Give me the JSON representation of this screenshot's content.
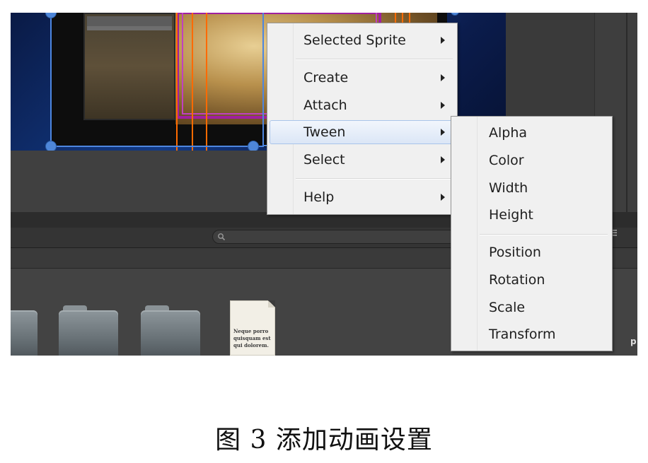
{
  "context_menu": {
    "items": [
      {
        "label": "Selected Sprite",
        "has_submenu": true
      },
      {
        "label": "Create",
        "has_submenu": true
      },
      {
        "label": "Attach",
        "has_submenu": true
      },
      {
        "label": "Tween",
        "has_submenu": true,
        "highlighted": true
      },
      {
        "label": "Select",
        "has_submenu": true
      },
      {
        "label": "Help",
        "has_submenu": true
      }
    ]
  },
  "tween_submenu": {
    "items": [
      {
        "label": "Alpha"
      },
      {
        "label": "Color"
      },
      {
        "label": "Width"
      },
      {
        "label": "Height"
      },
      {
        "label": "Position"
      },
      {
        "label": "Rotation"
      },
      {
        "label": "Scale"
      },
      {
        "label": "Transform"
      }
    ]
  },
  "asset_browser": {
    "document_thumbnail_text": [
      "Neque porro",
      "quisquam est",
      "qui dolorem."
    ],
    "edge_text": "p"
  },
  "caption": "图 3  添加动画设置",
  "icons": [
    "search-icon",
    "folder-icon",
    "document-icon",
    "menu-icon",
    "submenu-arrow-icon"
  ],
  "colors": {
    "selection_handle": "#4e86d8",
    "guide_line": "#ff6a00",
    "sprite_outline": "#a020a0",
    "menu_highlight": "#dbe6f6"
  }
}
